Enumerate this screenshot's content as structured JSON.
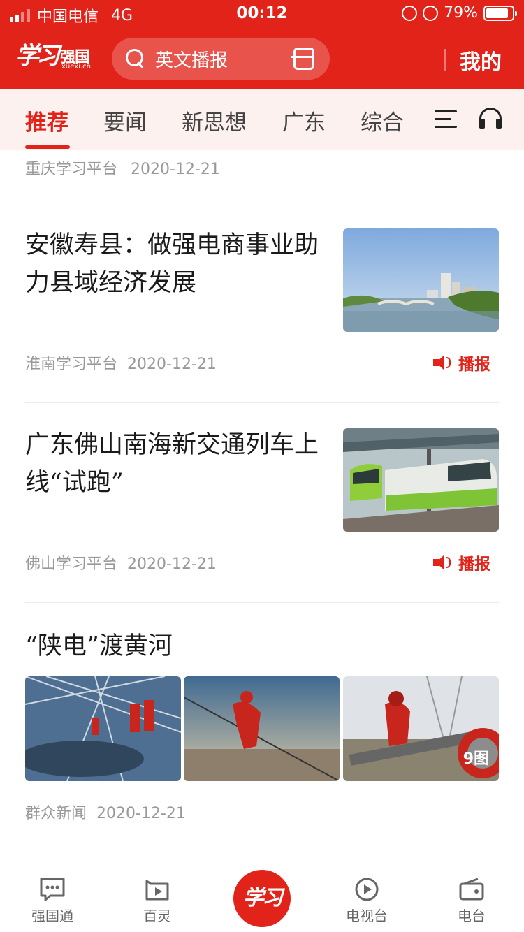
{
  "status_bar": {
    "carrier": "中国电信",
    "network": "4G",
    "time": "00:12",
    "battery": "79%",
    "battery_level": 0.79
  },
  "header": {
    "logo_script": "学习",
    "logo_name": "强国",
    "logo_domain": "xuexi.cn",
    "search_text": "英文播报",
    "mine_label": "我的"
  },
  "tabs": [
    {
      "label": "推荐",
      "active": true
    },
    {
      "label": "要闻",
      "active": false
    },
    {
      "label": "新思想",
      "active": false
    },
    {
      "label": "广东",
      "active": false
    },
    {
      "label": "综合",
      "active": false
    }
  ],
  "feed": {
    "partial": {
      "source": "重庆学习平台",
      "date": "2020-12-21"
    },
    "articles": [
      {
        "title": "安徽寿县：做强电商事业助力县域经济发展",
        "source": "淮南学习平台",
        "date": "2020-12-21",
        "broadcast": "播报"
      },
      {
        "title": "广东佛山南海新交通列车上线“试跑”",
        "source": "佛山学习平台",
        "date": "2020-12-21",
        "broadcast": "播报"
      }
    ],
    "gallery": {
      "title": "“陕电”渡黄河",
      "count_label": "9图",
      "source": "群众新闻",
      "date": "2020-12-21"
    }
  },
  "bottom_nav": [
    {
      "label": "强国通",
      "icon": "chat-icon"
    },
    {
      "label": "百灵",
      "icon": "video-play-icon"
    },
    {
      "label": "学习",
      "icon": "xuexi-logo"
    },
    {
      "label": "电视台",
      "icon": "tv-play-icon"
    },
    {
      "label": "电台",
      "icon": "radio-icon"
    }
  ],
  "colors": {
    "brand": "#e2231a",
    "tab_bg": "#fdf1ef",
    "meta_text": "#999999"
  }
}
